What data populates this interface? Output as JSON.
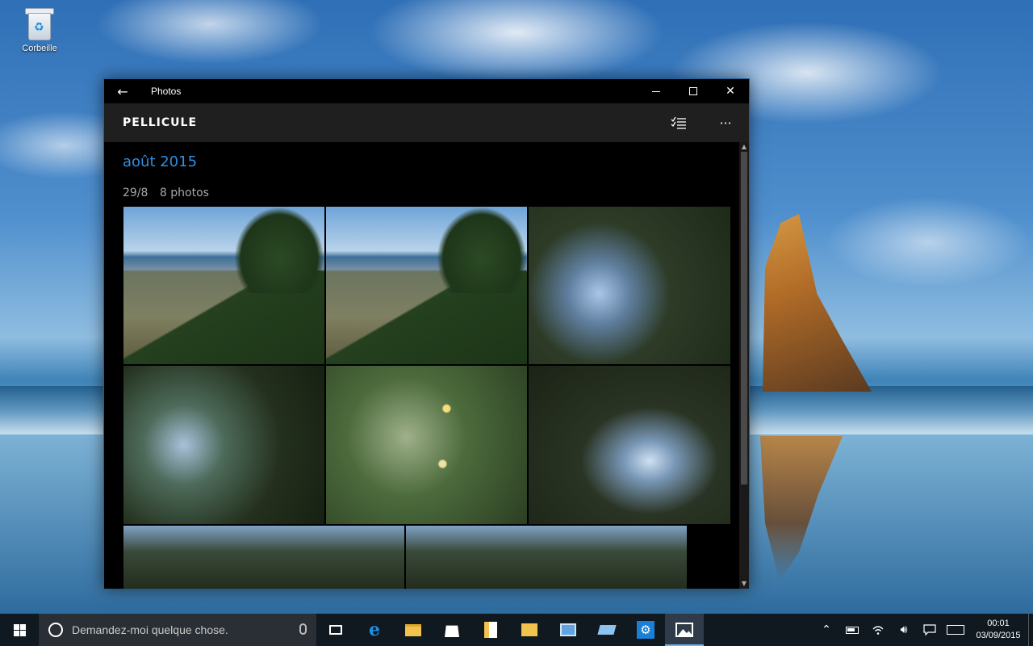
{
  "desktop": {
    "icons": [
      {
        "label": "Corbeille",
        "icon": "recycle-bin-icon"
      }
    ]
  },
  "window": {
    "title": "Photos",
    "controls": {
      "back": "←",
      "minimize": "minimize",
      "maximize": "maximize",
      "close": "✕"
    },
    "appbar": {
      "title": "PELLICULE",
      "select_icon": "multi-select-icon",
      "more_label": "···"
    },
    "gallery": {
      "month": "août 2015",
      "groups": [
        {
          "date": "29/8",
          "count": "8 photos"
        }
      ],
      "photos": [
        {
          "name": "photo-1"
        },
        {
          "name": "photo-2"
        },
        {
          "name": "photo-3"
        },
        {
          "name": "photo-4"
        },
        {
          "name": "photo-5"
        },
        {
          "name": "photo-6"
        },
        {
          "name": "photo-7"
        },
        {
          "name": "photo-8"
        }
      ]
    }
  },
  "taskbar": {
    "search_placeholder": "Demandez-moi quelque chose.",
    "apps": [
      "task-view",
      "edge",
      "file-explorer",
      "store",
      "documents",
      "folder",
      "contacts",
      "devices",
      "settings",
      "photos"
    ],
    "active_app": "photos",
    "clock": {
      "time": "00:01",
      "date": "03/09/2015"
    }
  },
  "colors": {
    "accent": "#2e8fe0",
    "appbar_bg": "#1f1f1f",
    "taskbar_bg": "#101820"
  }
}
